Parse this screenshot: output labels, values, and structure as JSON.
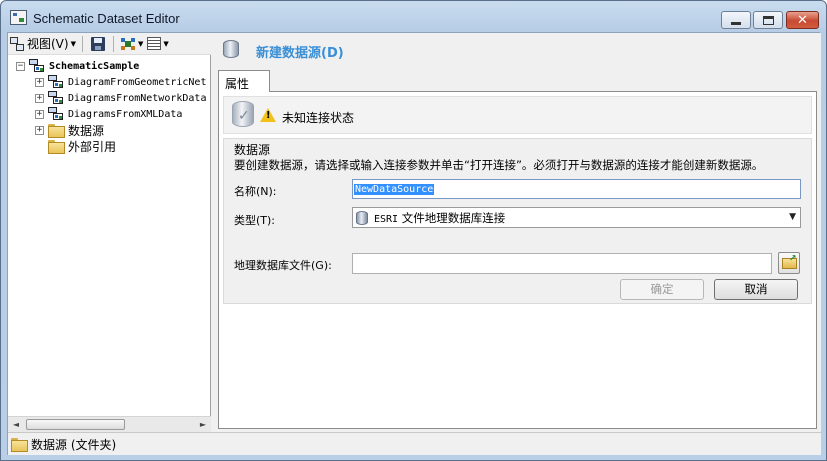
{
  "window": {
    "title": "Schematic Dataset Editor",
    "buttons": {
      "minimize": "",
      "maximize": "",
      "close": "✕"
    }
  },
  "toolbar": {
    "view_label": "视图(V)",
    "view_dropdown": "▼",
    "layout_dropdown": "▼",
    "props_dropdown": "▼"
  },
  "tree": {
    "root": {
      "label": "SchematicSample",
      "expander": "−",
      "icon": "schematic-dataset-icon"
    },
    "items": [
      {
        "label": "DiagramFromGeometricNet",
        "expander": "+",
        "icon": "diagram-template-icon"
      },
      {
        "label": "DiagramsFromNetworkData",
        "expander": "+",
        "icon": "diagram-template-icon"
      },
      {
        "label": "DiagramsFromXMLData",
        "expander": "+",
        "icon": "diagram-template-icon"
      },
      {
        "label": "数据源",
        "expander": "+",
        "icon": "folder-icon"
      },
      {
        "label": "外部引用",
        "expander": "",
        "icon": "folder-icon"
      }
    ]
  },
  "scrollbar": {
    "left_arrow": "◄",
    "right_arrow": "►"
  },
  "header": {
    "title": "新建数据源(D)",
    "icon": "database-icon"
  },
  "tabs": [
    {
      "label": "属性",
      "active": true
    }
  ],
  "status": {
    "text": "未知连接状态",
    "icon": "warning-icon"
  },
  "datasource": {
    "group_title": "数据源",
    "description": "要创建数据源，请选择或输入连接参数并单击“打开连接”。必须打开与数据源的连接才能创建新数据源。",
    "name_label": "名称(N):",
    "name_value": "NewDataSource",
    "type_label": "类型(T):",
    "type_value_prefix": "ESRI",
    "type_value": "文件地理数据库连接",
    "type_arrow": "▼",
    "gdb_label": "地理数据库文件(G):",
    "gdb_value": "",
    "ok_label": "确定",
    "cancel_label": "取消"
  },
  "statusbar": {
    "text": "数据源 (文件夹)"
  },
  "colors": {
    "header_title": "#3a8fd6",
    "selection": "#3390ff",
    "close_button": "#c74a32"
  }
}
